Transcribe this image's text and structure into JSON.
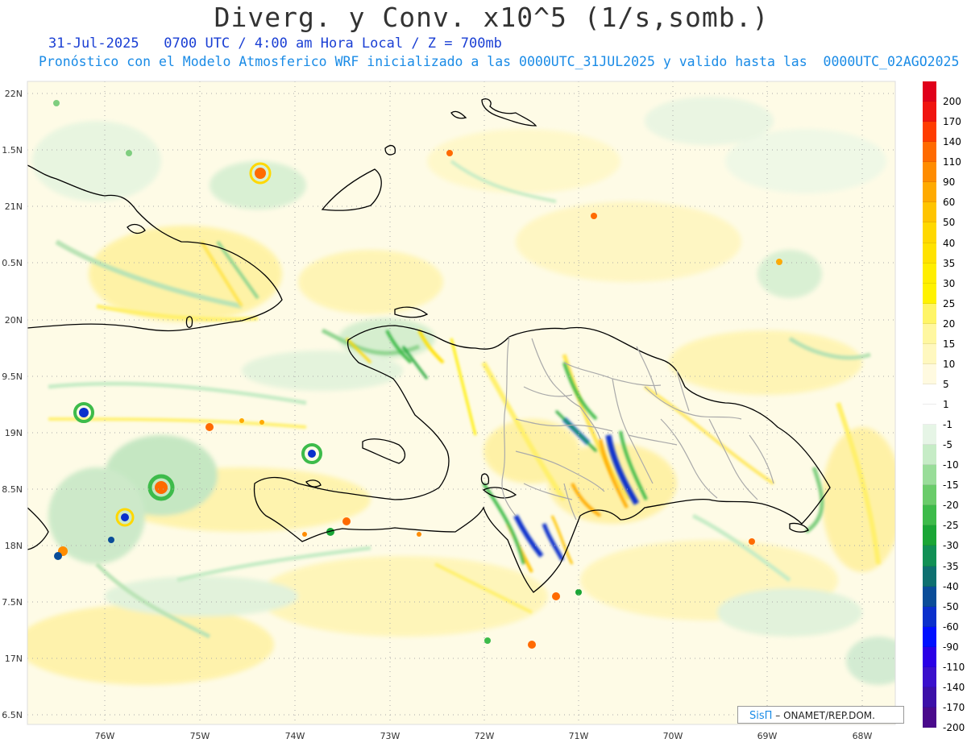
{
  "title": "Diverg. y Conv. x10^5 (1/s,somb.)",
  "subtitle1": "31-Jul-2025   0700 UTC / 4:00 am Hora Local / Z = 700mb",
  "subtitle2": "Pronóstico con el Modelo Atmosferico WRF inicializado a las 0000UTC_31JUL2025 y valido hasta las  0000UTC_02AGO2025",
  "lat_labels": [
    "22N",
    "1.5N",
    "21N",
    "0.5N",
    "20N",
    "9.5N",
    "19N",
    "8.5N",
    "18N",
    "7.5N",
    "17N",
    "6.5N"
  ],
  "lon_labels": [
    "76W",
    "75W",
    "74W",
    "73W",
    "72W",
    "71W",
    "70W",
    "69W",
    "68W"
  ],
  "colorbar": {
    "labels": [
      "200",
      "170",
      "140",
      "110",
      "90",
      "60",
      "50",
      "40",
      "35",
      "30",
      "25",
      "20",
      "15",
      "10",
      "5",
      "1",
      "-1",
      "-5",
      "-10",
      "-15",
      "-20",
      "-25",
      "-30",
      "-35",
      "-40",
      "-50",
      "-60",
      "-90",
      "-110",
      "-140",
      "-170",
      "-200"
    ],
    "colors": [
      "#e0001a",
      "#f0140f",
      "#ff3c00",
      "#ff6a00",
      "#ff8c00",
      "#ffaa00",
      "#ffc400",
      "#ffd800",
      "#ffe200",
      "#ffee00",
      "#fff200",
      "#fff566",
      "#fff7a0",
      "#fff8bf",
      "#fffae0",
      "#ffffff",
      "#ffffff",
      "#e6f5e6",
      "#c6ecc6",
      "#99dd99",
      "#6acc6a",
      "#3dbb4a",
      "#1aa636",
      "#119055",
      "#0e7070",
      "#0a4d99",
      "#0a30cc",
      "#0010ff",
      "#2a00e6",
      "#3a10cc",
      "#3c10a8",
      "#4a0a8c"
    ]
  },
  "credit": {
    "sis": "SisΠ",
    "org": "– ONAMET/REP.DOM."
  }
}
